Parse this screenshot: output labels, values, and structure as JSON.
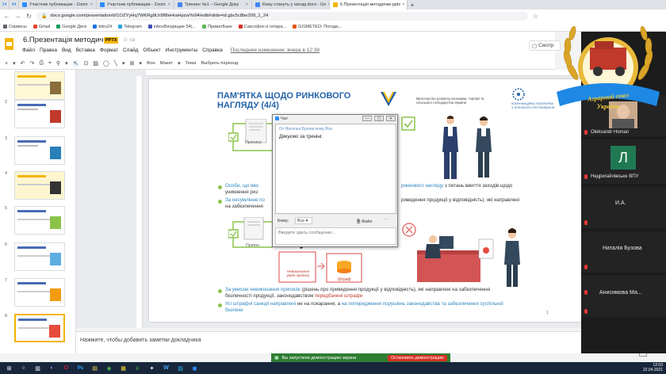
{
  "browser": {
    "tabs": [
      {
        "label": "24",
        "kind": "num"
      },
      {
        "label": "44",
        "kind": "num"
      },
      {
        "label": "Участник публикации - Zoom",
        "kind": "tab",
        "color": "#2d8cff"
      },
      {
        "label": "Участник публикации - Zoom",
        "kind": "tab",
        "color": "#2d8cff"
      },
      {
        "label": "Тренинг №1 – Google Доку",
        "kind": "tab",
        "color": "#4285f4"
      },
      {
        "label": "Кому стануть у нагоді.docx - Go",
        "kind": "tab",
        "color": "#4285f4"
      },
      {
        "label": "6.Презентація методички.pptx",
        "kind": "tab",
        "color": "#f4b400",
        "active": true
      }
    ],
    "new_tab": "+",
    "url": "docs.google.com/presentation/d/1OZYyHq7WKRg9Lh9f8leHraHpzwYo94/edit#slide=id.gbc5c8be209_1_24",
    "bookmarks": [
      {
        "label": "Сервисы",
        "color": "#5f6368"
      },
      {
        "label": "Gmail",
        "color": "#ea4335"
      },
      {
        "label": "Google Диск",
        "color": "#0f9d58"
      },
      {
        "label": "bitru24",
        "color": "#1a73e8"
      },
      {
        "label": "Telegram",
        "color": "#2aa3e0"
      },
      {
        "label": "inboxВходящие 54(...",
        "color": "#3f51b5"
      },
      {
        "label": "ПриватБанк",
        "color": "#5cb85c"
      },
      {
        "label": "Саксофон и гитара...",
        "color": "#d93025"
      },
      {
        "label": "GISMETEO: Погода...",
        "color": "#e65100"
      }
    ]
  },
  "slides_app": {
    "title": "6.Презентація методички",
    "badge": "PPTX",
    "menu": [
      "Файл",
      "Правка",
      "Вид",
      "Вставка",
      "Формат",
      "Слайд",
      "Объект",
      "Инструменты",
      "Справка"
    ],
    "last_edit": "Последнее изменение: вчера в 12:38",
    "present_label": "Смотр",
    "toolbar": {
      "background": "Фон",
      "layout": "Макет",
      "theme": "Тема",
      "transition": "Выбрать переход"
    },
    "slide_numbers": [
      "2",
      "3",
      "4",
      "5",
      "6",
      "7",
      "8"
    ],
    "notes_placeholder": "Нажмите, чтобы добавить заметки докладчика"
  },
  "slide": {
    "title_line1": "ПАМ'ЯТКА ЩОДО РИНКОВОГО",
    "title_line2": "НАГЛЯДУ (4/4)",
    "ministry": "Міністерство розвитку економіки, торгівлі та сільського господарства України",
    "partner": "КОМУНІКАЦІЙНА ПЛАТФОРМА З ТЕХНІЧНОГО РЕГУЛЮВАННЯ",
    "para1_a": "Особи, що вво",
    "para1_b": "ринкового нагляду",
    "para1_c": "з питань вжиття заходів щодо",
    "para1_d": "уникнення риз",
    "para2_a": "За несумлінне по",
    "para2_b": "риведення продукції у відповідність), які направлені",
    "para2_c": "на забезпечення",
    "label_prescription1": "Приписи",
    "label_prescription2": "Припис",
    "label_non_compliance": "Невиконання умов припису",
    "label_fine": "Штраф",
    "para3_a": "За умисне невиконання приписів",
    "para3_b": "(рішень про приведення продукції у відповідність), які направлені на забезпечення",
    "para3_c": "безпечності продукції, законодавством",
    "para3_d": "передбачені штрафи",
    "para4_a": "Усі штрафні санкції направлені",
    "para4_b": "не на покарання, а",
    "para4_c": "на попередження порушень законодавства та забезпечення суспільної",
    "para4_d": "безпеки",
    "page_number": "1"
  },
  "chat": {
    "window_title": "Чат",
    "from_line": "От Наталья Бузова кому Все:",
    "message": "Дякуємо за тренінг.",
    "to_label": "Кому:",
    "to_value": "Все",
    "file_label": "Файл",
    "more": "···",
    "input_placeholder": "Введите здесь сообщение..."
  },
  "zoom": {
    "participants": [
      {
        "name": "Oleksandr Homan"
      },
      {
        "name": "Недригайлівське ВПУ",
        "initial": "Л"
      },
      {
        "name": "И.А."
      },
      {
        "name": "Наталія Бузова"
      },
      {
        "name": "Анисимова Ма..."
      }
    ],
    "share_banner": "Вы запустили демонстрацию экрана",
    "stop_share": "Остановить демонстрацию"
  },
  "badge": {
    "line1": "Аграрний союз",
    "line2": "України"
  },
  "taskbar": {
    "time": "12:03",
    "date": "22.04.2021"
  },
  "colors": {
    "slides_accent": "#f4b400",
    "slide_title": "#2463a8",
    "bullet": "#8bc34a",
    "share_green": "#2e7d32",
    "stop_red": "#d93025"
  }
}
